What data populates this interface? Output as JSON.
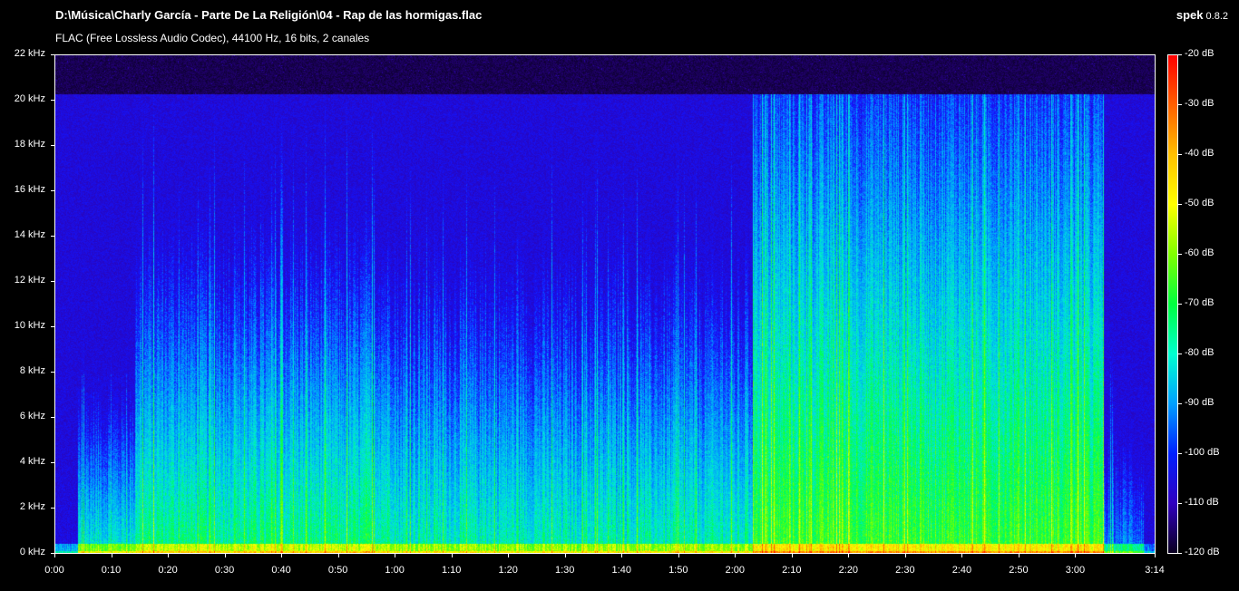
{
  "header": {
    "file_path": "D:\\Música\\Charly García - Parte De La Religión\\04 - Rap de las hormigas.flac",
    "codec_info": "FLAC (Free Lossless Audio Codec), 44100 Hz, 16 bits, 2 canales",
    "app_name": "spek",
    "app_version": "0.8.2"
  },
  "axes": {
    "y_labels": [
      "22 kHz",
      "20 kHz",
      "18 kHz",
      "16 kHz",
      "14 kHz",
      "12 kHz",
      "10 kHz",
      "8 kHz",
      "6 kHz",
      "4 kHz",
      "2 kHz",
      "0 kHz"
    ],
    "x_labels": [
      "0:00",
      "0:10",
      "0:20",
      "0:30",
      "0:40",
      "0:50",
      "1:00",
      "1:10",
      "1:20",
      "1:30",
      "1:40",
      "1:50",
      "2:00",
      "2:10",
      "2:20",
      "2:30",
      "2:40",
      "2:50",
      "3:00",
      "3:14"
    ],
    "x_seconds": [
      0,
      10,
      20,
      30,
      40,
      50,
      60,
      70,
      80,
      90,
      100,
      110,
      120,
      130,
      140,
      150,
      160,
      170,
      180,
      194
    ],
    "duration_seconds": 194,
    "max_khz": 22
  },
  "colorbar": {
    "labels": [
      "-20 dB",
      "-30 dB",
      "-40 dB",
      "-50 dB",
      "-60 dB",
      "-70 dB",
      "-80 dB",
      "-90 dB",
      "-100 dB",
      "-110 dB",
      "-120 dB"
    ]
  }
}
